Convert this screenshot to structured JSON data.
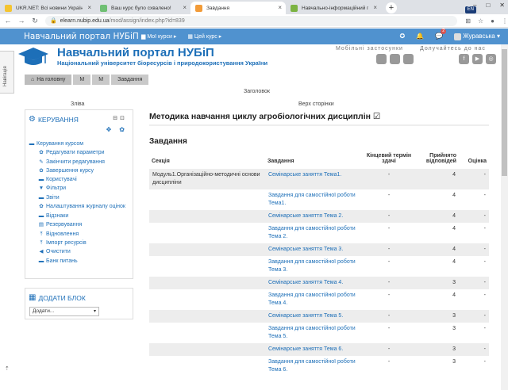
{
  "browser": {
    "tabs": [
      {
        "title": "UKR.NET: Всі новини України, с",
        "favicon_color": "#f4c430",
        "active": false
      },
      {
        "title": "Ваш курс було схвалено!",
        "favicon_color": "#6fbf73",
        "active": false
      },
      {
        "title": "Завдання",
        "favicon_color": "#f29b38",
        "active": true
      },
      {
        "title": "Навчально-інформаційний пор",
        "favicon_color": "#7cb342",
        "active": false
      }
    ],
    "new_tab": "+",
    "lang_indicator": "EN",
    "url_host": "elearn.nubip.edu.ua",
    "url_path": "/mod/assign/index.php?id=839",
    "window_controls": [
      "–",
      "□",
      "✕"
    ]
  },
  "navbar": {
    "brand": "Навчальний портал НУБіП",
    "my_courses": "Мої курси",
    "this_course": "Цей курс",
    "message_count": "2",
    "user_name": "Журавська"
  },
  "header": {
    "site_title": "Навчальний портал НУБіП",
    "site_subtitle": "Національний університет біоресурсів і природокористування України",
    "apps_label": "Мобільні застосунки",
    "join_label": "Долучайтесь до нас"
  },
  "side_tab": "Навігація",
  "breadcrumb": [
    "На головну",
    "М",
    "М",
    "Завдання"
  ],
  "regions": {
    "header": "Заголовок",
    "left": "Зліва",
    "top": "Верх сторінки"
  },
  "admin_block": {
    "title": "КЕРУВАННЯ",
    "root": "Керування курсом",
    "items": [
      {
        "label": "Редагувати параметри",
        "icon": "gear-icon",
        "glyph": "✿"
      },
      {
        "label": "Закінчити редагування",
        "icon": "pencil-icon",
        "glyph": "✎"
      },
      {
        "label": "Завершення курсу",
        "icon": "gear-icon",
        "glyph": "✿"
      },
      {
        "label": "Користувачі",
        "icon": "folder-icon",
        "glyph": "▬"
      },
      {
        "label": "Фільтри",
        "icon": "filter-icon",
        "glyph": "▼"
      },
      {
        "label": "Звіти",
        "icon": "folder-icon",
        "glyph": "▬"
      },
      {
        "label": "Налаштування журналу оцінок",
        "icon": "gear-icon",
        "glyph": "✿"
      },
      {
        "label": "Відзнаки",
        "icon": "folder-icon",
        "glyph": "▬"
      },
      {
        "label": "Резервування",
        "icon": "file-icon",
        "glyph": "▤"
      },
      {
        "label": "Відновлення",
        "icon": "upload-icon",
        "glyph": "⤒"
      },
      {
        "label": "Імпорт ресурсів",
        "icon": "upload-icon",
        "glyph": "⤒"
      },
      {
        "label": "Очистити",
        "icon": "arrow-left-icon",
        "glyph": "◀"
      },
      {
        "label": "Банк питань",
        "icon": "folder-icon",
        "glyph": "▬"
      }
    ]
  },
  "add_block": {
    "title": "ДОДАТИ БЛОК",
    "select_value": "Додати..."
  },
  "main": {
    "title": "Методика навчання циклу агробіологічних дисциплін",
    "section_heading": "Завдання",
    "columns": [
      "Секція",
      "Завдання",
      "Кінцевий термін здачі",
      "Прийнято відповідей",
      "Оцінка"
    ],
    "rows": [
      {
        "section": "Модуль1.Організаційно-методичні основи дисципліни",
        "task": "Семінарське заняття Тема1.",
        "due": "-",
        "accepted": "4",
        "grade": "-"
      },
      {
        "section": "",
        "task": "Завдання для самостійної роботи Тема1.",
        "due": "-",
        "accepted": "4",
        "grade": "-"
      },
      {
        "section": "",
        "task": "Семінарське заняття Тема 2.",
        "due": "-",
        "accepted": "4",
        "grade": "-"
      },
      {
        "section": "",
        "task": "Завдання для самостійної роботи Тема 2.",
        "due": "-",
        "accepted": "4",
        "grade": "-"
      },
      {
        "section": "",
        "task": "Семінарське заняття Тема 3.",
        "due": "-",
        "accepted": "4",
        "grade": "-"
      },
      {
        "section": "",
        "task": "Завдання для самостійної роботи Тема 3.",
        "due": "-",
        "accepted": "4",
        "grade": "-"
      },
      {
        "section": "",
        "task": "Семінарське заняття Тема 4.",
        "due": "-",
        "accepted": "3",
        "grade": "-"
      },
      {
        "section": "",
        "task": "Завдання для самостійної роботи Тема 4.",
        "due": "-",
        "accepted": "4",
        "grade": "-"
      },
      {
        "section": "",
        "task": "Семінарське заняття Тема 5.",
        "due": "-",
        "accepted": "3",
        "grade": "-"
      },
      {
        "section": "",
        "task": "Завдання для самостійної роботи Тема 5.",
        "due": "-",
        "accepted": "3",
        "grade": "-"
      },
      {
        "section": "",
        "task": "Семінарське заняття Тема 6.",
        "due": "-",
        "accepted": "3",
        "grade": "-"
      },
      {
        "section": "",
        "task": "Завдання для самостійної роботи Тема 6.",
        "due": "-",
        "accepted": "3",
        "grade": "-"
      }
    ]
  },
  "colors": {
    "navbar": "#5092cf",
    "brand_blue": "#1d6fb8",
    "stripe": "#ededed",
    "breadcrumb": "#c9c9c9"
  }
}
